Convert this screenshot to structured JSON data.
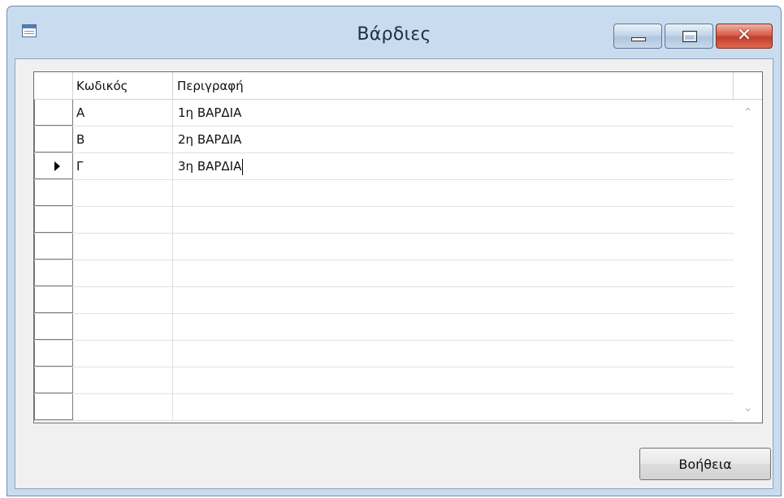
{
  "window": {
    "title": "Βάρδιες",
    "close_glyph": "✕"
  },
  "grid": {
    "columns": {
      "code": "Κωδικός",
      "description": "Περιγραφή"
    },
    "rows": [
      {
        "code": "Α",
        "description": "1η ΒΑΡΔΙΑ",
        "current": false
      },
      {
        "code": "Β",
        "description": "2η ΒΑΡΔΙΑ",
        "current": false
      },
      {
        "code": "Γ",
        "description": "3η ΒΑΡΔΙΑ",
        "current": true
      },
      {
        "code": "",
        "description": "",
        "current": false
      },
      {
        "code": "",
        "description": "",
        "current": false
      },
      {
        "code": "",
        "description": "",
        "current": false
      },
      {
        "code": "",
        "description": "",
        "current": false
      },
      {
        "code": "",
        "description": "",
        "current": false
      },
      {
        "code": "",
        "description": "",
        "current": false
      },
      {
        "code": "",
        "description": "",
        "current": false
      },
      {
        "code": "",
        "description": "",
        "current": false
      },
      {
        "code": "",
        "description": "",
        "current": false
      }
    ],
    "scroll_up_glyph": "⌃",
    "scroll_down_glyph": "⌄"
  },
  "buttons": {
    "help": "Βοήθεια"
  }
}
